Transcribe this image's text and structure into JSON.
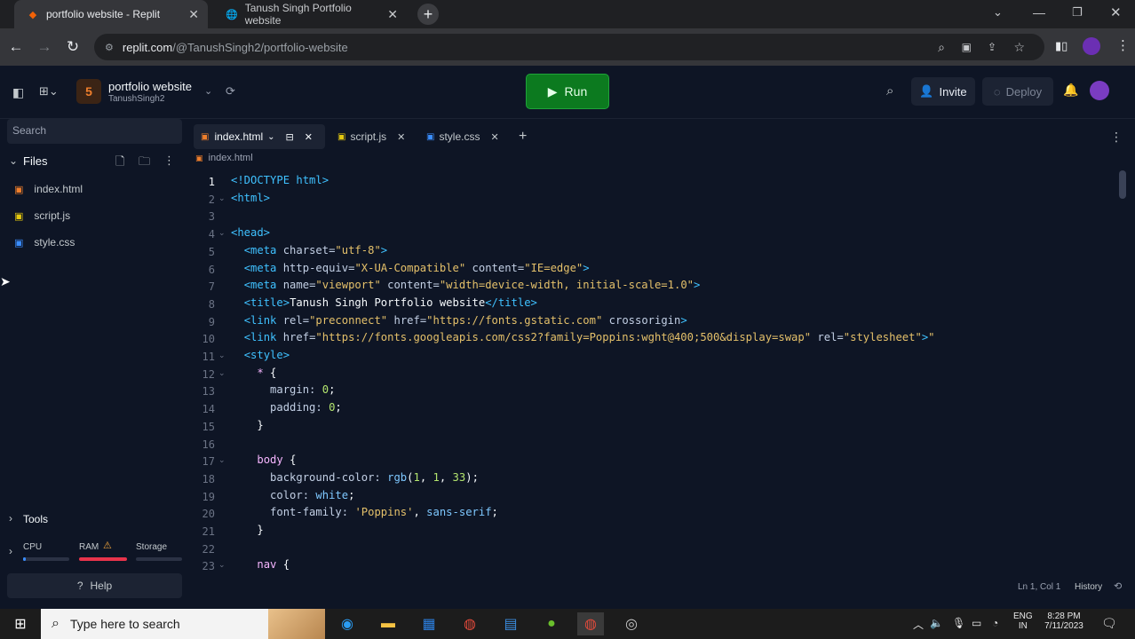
{
  "browser": {
    "tabs": [
      {
        "title": "portfolio website - Replit",
        "active": true
      },
      {
        "title": "Tanush Singh Portfolio website",
        "active": false
      }
    ],
    "url_host": "replit.com",
    "url_path": "/@TanushSingh2/portfolio-website"
  },
  "replit": {
    "project_name": "portfolio website",
    "owner": "TanushSingh2",
    "run_label": "Run",
    "invite_label": "Invite",
    "deploy_label": "Deploy"
  },
  "sidebar": {
    "search_placeholder": "Search",
    "files_label": "Files",
    "files": [
      "index.html",
      "script.js",
      "style.css"
    ],
    "tools_label": "Tools",
    "resources": [
      "CPU",
      "RAM",
      "Storage"
    ],
    "help_label": "Help"
  },
  "editor": {
    "tabs": [
      "index.html",
      "script.js",
      "style.css"
    ],
    "breadcrumb": "index.html",
    "status_position": "Ln 1, Col 1",
    "history_label": "History",
    "lines": [
      "1",
      "2",
      "3",
      "4",
      "5",
      "6",
      "7",
      "8",
      "9",
      "10",
      "11",
      "12",
      "13",
      "14",
      "15",
      "16",
      "17",
      "18",
      "19",
      "20",
      "21",
      "22",
      "23"
    ]
  },
  "taskbar": {
    "search_placeholder": "Type here to search",
    "lang": "ENG",
    "region": "IN",
    "time": "8:28 PM",
    "date": "7/11/2023"
  },
  "colors": {
    "run_button": "#0c7a1f",
    "background": "#0e1525"
  }
}
